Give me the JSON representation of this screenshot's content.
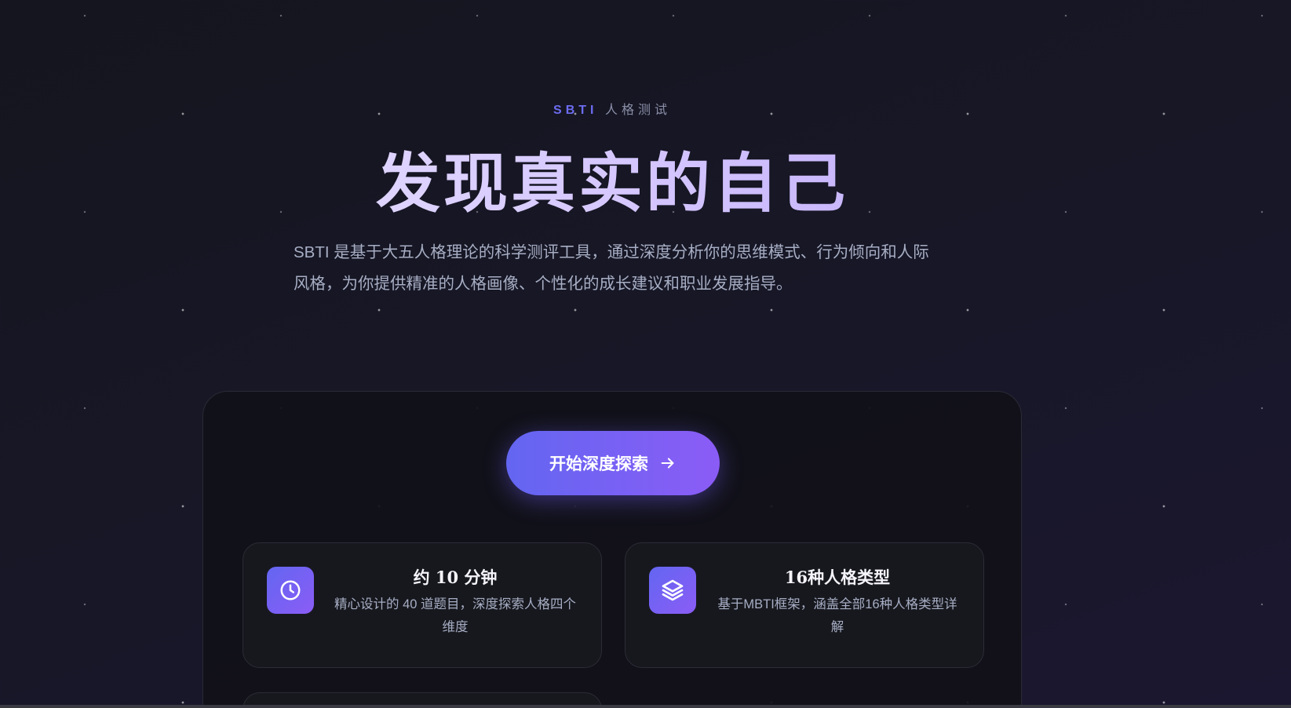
{
  "hero": {
    "eyebrow_brand": "SBTI",
    "eyebrow_rest": "人格测试",
    "title": "发现真实的自己",
    "description": "SBTI 是基于大五人格理论的科学测评工具，通过深度分析你的思维模式、行为倾向和人际风格，为你提供精准的人格画像、个性化的成长建议和职业发展指导。"
  },
  "cta": {
    "label": "开始深度探索",
    "icon": "arrow-right-icon"
  },
  "features": [
    {
      "icon": "clock-icon",
      "title": "约 10 分钟",
      "description": "精心设计的 40 道题目，深度探索人格四个维度"
    },
    {
      "icon": "layers-icon",
      "title": "16种人格类型",
      "description": "基于MBTI框架，涵盖全部16种人格类型详解"
    }
  ],
  "colors": {
    "accent_start": "#6366f1",
    "accent_end": "#8b5cf6",
    "background": "#15151f"
  }
}
